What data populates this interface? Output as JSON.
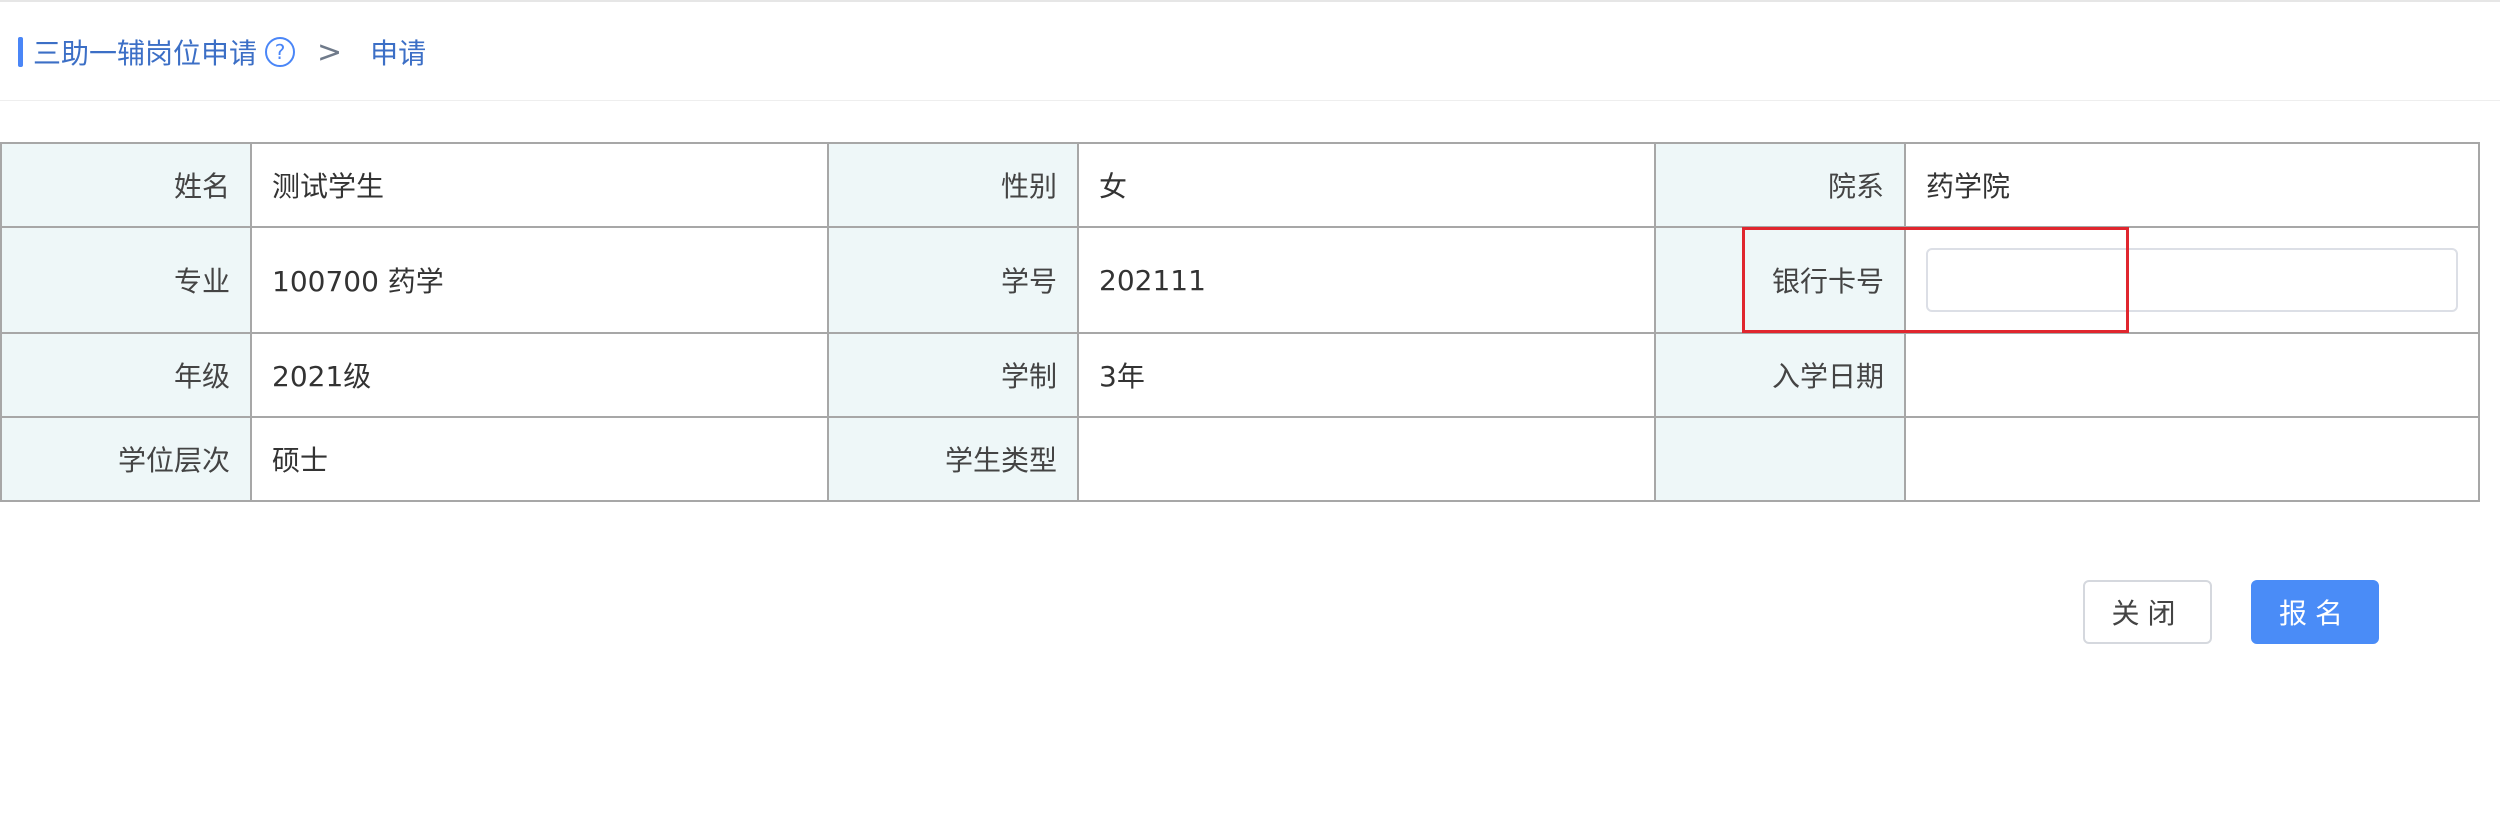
{
  "breadcrumb": {
    "parent": "三助一辅岗位申请",
    "help_symbol": "?",
    "separator": ">",
    "current": "申请"
  },
  "table": {
    "rows": [
      [
        {
          "label": "姓名",
          "value": "测试学生"
        },
        {
          "label": "性别",
          "value": "女"
        },
        {
          "label": "院系",
          "value": "药学院"
        }
      ],
      [
        {
          "label": "专业",
          "value": "100700 药学"
        },
        {
          "label": "学号",
          "value": "202111"
        },
        {
          "label": "银行卡号",
          "value": ""
        }
      ],
      [
        {
          "label": "年级",
          "value": "2021级"
        },
        {
          "label": "学制",
          "value": "3年"
        },
        {
          "label": "入学日期",
          "value": ""
        }
      ],
      [
        {
          "label": "学位层次",
          "value": "硕士"
        },
        {
          "label": "学生类型",
          "value": ""
        },
        {
          "label": "",
          "value": ""
        }
      ]
    ]
  },
  "bank_card": {
    "value": "",
    "placeholder": ""
  },
  "buttons": {
    "close": "关闭",
    "apply": "报名"
  },
  "colors": {
    "accent": "#4a8cf7",
    "label_bg": "#eef7f8",
    "highlight": "#e0262e"
  }
}
